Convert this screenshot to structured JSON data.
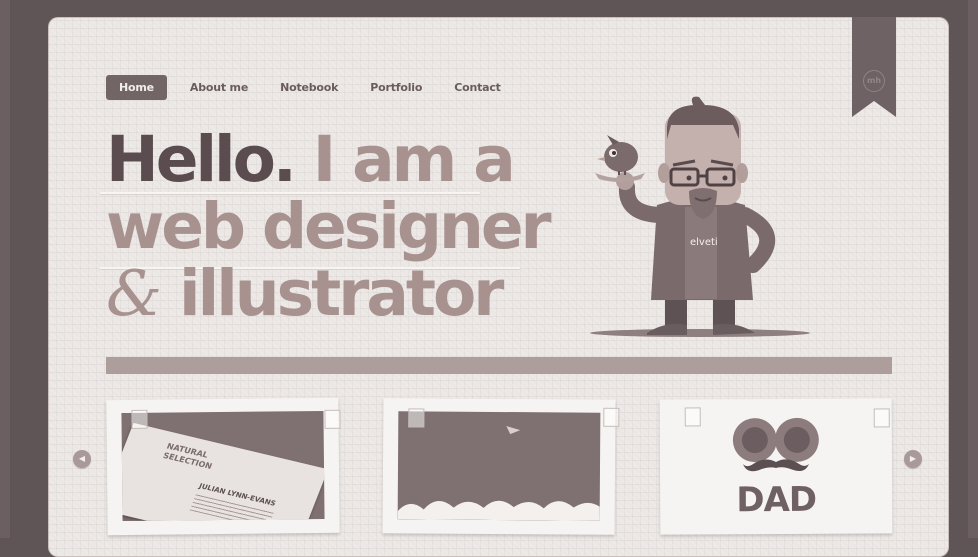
{
  "nav": {
    "items": [
      {
        "label": "Home",
        "active": true
      },
      {
        "label": "About me",
        "active": false
      },
      {
        "label": "Notebook",
        "active": false
      },
      {
        "label": "Portfolio",
        "active": false
      },
      {
        "label": "Contact",
        "active": false
      }
    ]
  },
  "ribbon": {
    "mark": "mh"
  },
  "hero": {
    "greeting": "Hello.",
    "line1_rest": " I am a",
    "line2": "web designer",
    "ampersand": "&",
    "line3_rest": " illustrator",
    "shirt_text": "elveti"
  },
  "portfolio": {
    "card1": {
      "card_lines": [
        "NATURAL",
        "SELECTION",
        "JULIAN LYNN-EVANS"
      ]
    },
    "card3": {
      "text": "DAD"
    }
  },
  "colors": {
    "background": "#5f5456",
    "paper": "#ebe7e5",
    "nav_active": "#726566",
    "headline_dark": "#5b4d4f",
    "headline_light": "#a8928f",
    "bar": "#ad9e9c"
  }
}
